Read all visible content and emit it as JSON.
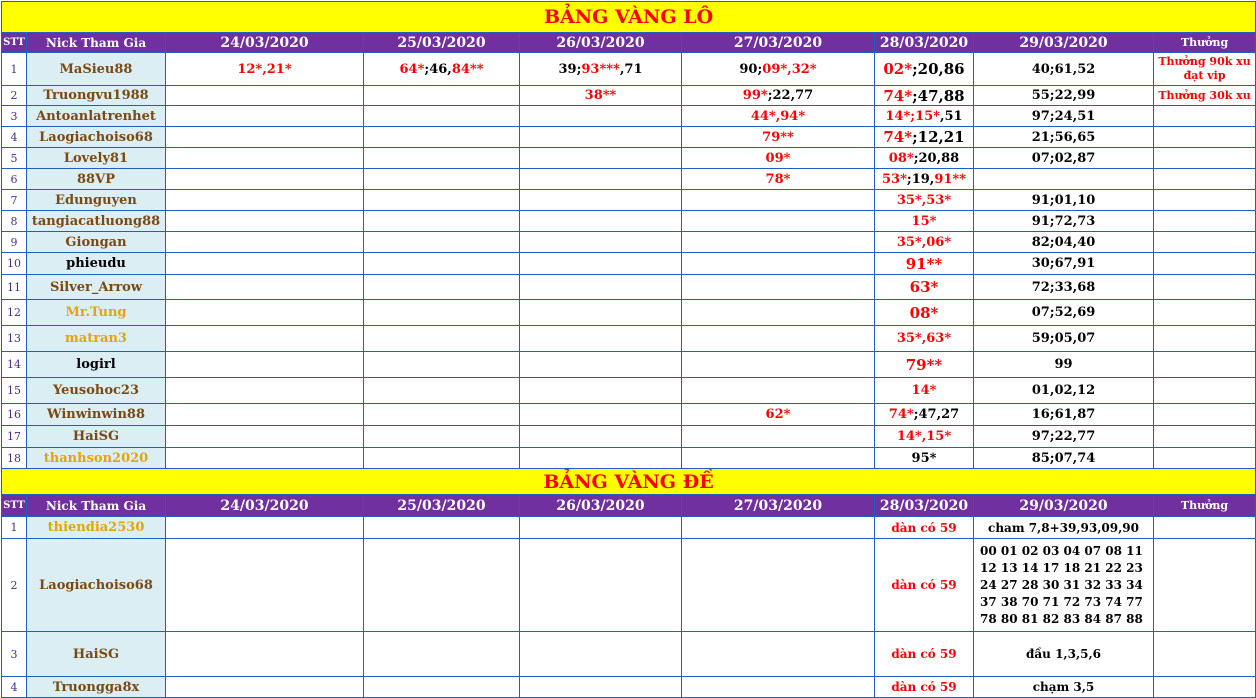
{
  "lo": {
    "title": "BẢNG VÀNG LÔ",
    "headers": {
      "stt": "STT",
      "nick": "Nick Tham Gia",
      "d1": "24/03/2020",
      "d2": "25/03/2020",
      "d3": "26/03/2020",
      "d4": "27/03/2020",
      "d5": "28/03/2020",
      "d6": "29/03/2020",
      "reward": "Thưởng"
    },
    "rows": [
      {
        "n": "1",
        "nick": "MaSieu88",
        "c1r": "12*,21*",
        "c2r": "64*",
        "c2b": ";46,",
        "c2r2": "84**",
        "c3b": "39;",
        "c3r": "93***",
        "c3b2": ",71",
        "c4b": "90;",
        "c4r": "09*,32*",
        "c5r": "02*",
        "c5b": ";20,86",
        "c6": "40;61,52",
        "reward": "Thưởng 90k xu đạt vip"
      },
      {
        "n": "2",
        "nick": "Truongvu1988",
        "c3r": "38**",
        "c4r": "99*",
        "c4b": ";22,77",
        "c5r": "74*",
        "c5b": ";47,88",
        "c6": "55;22,99",
        "reward": "Thưởng 30k xu"
      },
      {
        "n": "3",
        "nick": "Antoanlatrenhet",
        "c4r": "44*,94*",
        "c5r": "14*;15*",
        "c5b": ",51",
        "c6": "97;24,51"
      },
      {
        "n": "4",
        "nick": "Laogiachoiso68",
        "c4r": "79**",
        "c5r": "74*",
        "c5b": ";12,21",
        "c6": "21;56,65"
      },
      {
        "n": "5",
        "nick": "Lovely81",
        "c4r": "09*",
        "c5r": "08*",
        "c5b": ";20,88",
        "c6": "07;02,87"
      },
      {
        "n": "6",
        "nick": "88VP",
        "c4r": "78*",
        "c5r": "53*",
        "c5b": ";19,",
        "c5r2": "91**",
        "c6": ""
      },
      {
        "n": "7",
        "nick": "Edunguyen",
        "c5r": "35*,53*",
        "c6": "91;01,10"
      },
      {
        "n": "8",
        "nick": "tangiacatluong88",
        "c5r": "15*",
        "c6": "91;72,73"
      },
      {
        "n": "9",
        "nick": "Giongan",
        "c5r": "35*,06*",
        "c6": "82;04,40"
      },
      {
        "n": "10",
        "nick": "phieudu",
        "c5r": "91**",
        "c6": "30;67,91"
      },
      {
        "n": "11",
        "nick": "Silver_Arrow",
        "c5r": "63*",
        "c6": "72;33,68"
      },
      {
        "n": "12",
        "nick": "Mr.Tung",
        "c5r": "08*",
        "c6": "07;52,69"
      },
      {
        "n": "13",
        "nick": "matran3",
        "c5r": "35*,63*",
        "c6": "59;05,07"
      },
      {
        "n": "14",
        "nick": "logirl",
        "c5r": "79**",
        "c6": "99"
      },
      {
        "n": "15",
        "nick": "Yeusohoc23",
        "c5r": "14*",
        "c6": "01,02,12"
      },
      {
        "n": "16",
        "nick": "Winwinwin88",
        "c4r": "62*",
        "c5r": "74*",
        "c5b": ";47,27",
        "c6": "16;61,87"
      },
      {
        "n": "17",
        "nick": "HaiSG",
        "c5r": "14*,15*",
        "c6": "97;22,77"
      },
      {
        "n": "18",
        "nick": "thanhson2020",
        "c5b": "95*",
        "c6": "85;07,74"
      }
    ]
  },
  "de": {
    "title": "BẢNG VÀNG ĐỀ",
    "headers": {
      "stt": "STT",
      "nick": "Nick Tham Gia",
      "d1": "24/03/2020",
      "d2": "25/03/2020",
      "d3": "26/03/2020",
      "d4": "27/03/2020",
      "d5": "28/03/2020",
      "d6": "29/03/2020",
      "reward": "Thưởng"
    },
    "rows": [
      {
        "n": "1",
        "nick": "thiendia2530",
        "c5": "dàn có 59",
        "c6": "cham 7,8+39,93,09,90"
      },
      {
        "n": "2",
        "nick": "Laogiachoiso68",
        "c5": "dàn có 59",
        "c6": "00 01 02 03 04 07 08 11 12 13 14 17 18 21 22 23 24 27 28 30 31 32 33 34 37 38 70 71 72 73 74 77 78 80 81 82 83 84 87 88"
      },
      {
        "n": "3",
        "nick": "HaiSG",
        "c5": "dàn có 59",
        "c6": "đầu 1,3,5,6"
      },
      {
        "n": "4",
        "nick": "Truongga8x",
        "c5": "dàn có 59",
        "c6": "chạm 3,5"
      }
    ]
  },
  "colors": {
    "title_bg": "#ffff00",
    "title_text": "#ff0000",
    "header_bg": "#7030a0",
    "nick_bg": "#dbeef4",
    "border": "#1f5fc4"
  }
}
